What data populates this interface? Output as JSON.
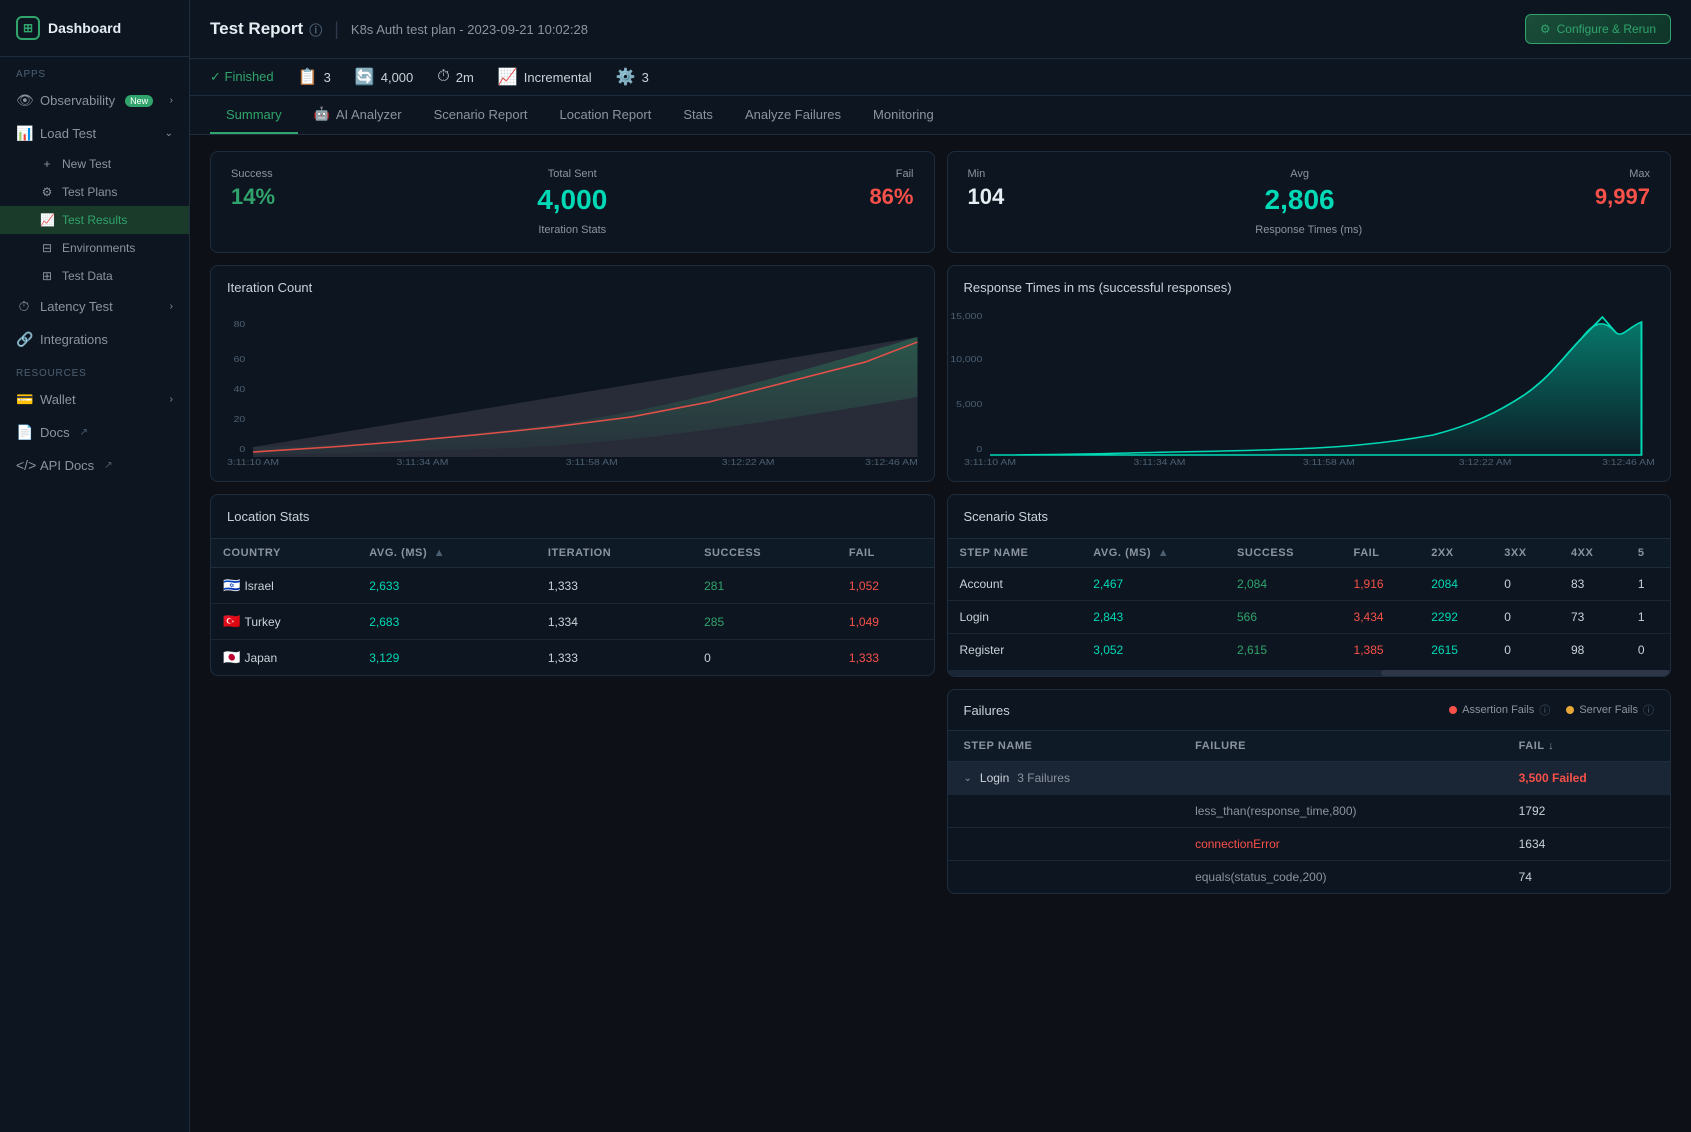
{
  "sidebar": {
    "logo": "Dashboard",
    "sections": {
      "apps_label": "APPS",
      "resources_label": "RESOURCES"
    },
    "items": {
      "dashboard": "Dashboard",
      "observability": "Observability",
      "observability_badge": "New",
      "load_test": "Load Test",
      "new_test": "New Test",
      "test_plans": "Test Plans",
      "test_results": "Test Results",
      "environments": "Environments",
      "test_data": "Test Data",
      "latency_test": "Latency Test",
      "integrations": "Integrations",
      "wallet": "Wallet",
      "docs": "Docs",
      "api_docs": "API Docs"
    }
  },
  "header": {
    "title": "Test Report",
    "separator": "|",
    "subtitle": "K8s Auth test plan - 2023-09-21 10:02:28",
    "configure_btn": "Configure & Rerun"
  },
  "status_bar": {
    "finished": "✓ Finished",
    "stats": [
      {
        "icon": "📋",
        "value": "3"
      },
      {
        "icon": "🔄",
        "value": "4,000"
      },
      {
        "icon": "⏱",
        "value": "2m"
      },
      {
        "icon": "📈",
        "value": "Incremental"
      },
      {
        "icon": "⚙️",
        "value": "3"
      }
    ]
  },
  "tabs": [
    {
      "id": "summary",
      "label": "Summary",
      "active": true
    },
    {
      "id": "ai-analyzer",
      "label": "AI Analyzer",
      "icon": "🤖"
    },
    {
      "id": "scenario-report",
      "label": "Scenario Report"
    },
    {
      "id": "location-report",
      "label": "Location Report"
    },
    {
      "id": "stats",
      "label": "Stats"
    },
    {
      "id": "analyze-failures",
      "label": "Analyze Failures"
    },
    {
      "id": "monitoring",
      "label": "Monitoring"
    }
  ],
  "iteration_stats": {
    "success_label": "Success",
    "success_value": "14%",
    "total_sent_label": "Total Sent",
    "total_sent_value": "4,000",
    "fail_label": "Fail",
    "fail_value": "86%",
    "footer": "Iteration Stats"
  },
  "response_times": {
    "min_label": "Min",
    "min_value": "104",
    "avg_label": "Avg",
    "avg_value": "2,806",
    "max_label": "Max",
    "max_value": "9,997",
    "footer": "Response Times (ms)"
  },
  "iteration_chart": {
    "title": "Iteration Count",
    "x_labels": [
      "3:11:10 AM",
      "3:11:34 AM",
      "3:11:58 AM",
      "3:12:22 AM",
      "3:12:46 AM"
    ]
  },
  "response_chart": {
    "title": "Response Times in ms (successful responses)",
    "y_labels": [
      "15,000",
      "10,000",
      "5,000",
      "0"
    ],
    "x_labels": [
      "3:11:10 AM",
      "3:11:34 AM",
      "3:11:58 AM",
      "3:12:22 AM",
      "3:12:46 AM"
    ]
  },
  "location_stats": {
    "title": "Location Stats",
    "columns": [
      "COUNTRY",
      "AVG. (MS)",
      "ITERATION",
      "SUCCESS",
      "FAIL"
    ],
    "rows": [
      {
        "flag": "🇮🇱",
        "country": "Israel",
        "avg": "2,633",
        "iteration": "1,333",
        "success": "281",
        "fail": "1,052"
      },
      {
        "flag": "🇹🇷",
        "country": "Turkey",
        "avg": "2,683",
        "iteration": "1,334",
        "success": "285",
        "fail": "1,049"
      },
      {
        "flag": "🇯🇵",
        "country": "Japan",
        "avg": "3,129",
        "iteration": "1,333",
        "success": "0",
        "fail": "1,333"
      }
    ]
  },
  "scenario_stats": {
    "title": "Scenario Stats",
    "columns": [
      "STEP NAME",
      "AVG. (MS)",
      "SUCCESS",
      "FAIL",
      "2XX",
      "3XX",
      "4XX",
      "5"
    ],
    "rows": [
      {
        "step": "Account",
        "avg": "2,467",
        "success": "2,084",
        "fail": "1,916",
        "twoxx": "2084",
        "threexx": "0",
        "fourxx": "83",
        "five": "1"
      },
      {
        "step": "Login",
        "avg": "2,843",
        "success": "566",
        "fail": "3,434",
        "twoxx": "2292",
        "threexx": "0",
        "fourxx": "73",
        "five": "1"
      },
      {
        "step": "Register",
        "avg": "3,052",
        "success": "2,615",
        "fail": "1,385",
        "twoxx": "2615",
        "threexx": "0",
        "fourxx": "98",
        "five": "0"
      }
    ]
  },
  "failures": {
    "title": "Failures",
    "legend": {
      "assertion": "Assertion Fails",
      "server": "Server Fails"
    },
    "columns": [
      "Step Name",
      "Failure",
      "Fail ↓"
    ],
    "rows": [
      {
        "step": "Login",
        "expand": "3 Failures",
        "fail_count": "3,500 Failed",
        "sub_rows": [
          {
            "failure": "less_than(response_time,800)",
            "fail": "1792",
            "type": "assertion"
          },
          {
            "failure": "connectionError",
            "fail": "1634",
            "type": "server"
          },
          {
            "failure": "equals(status_code,200)",
            "fail": "74",
            "type": "assertion"
          }
        ]
      }
    ]
  }
}
